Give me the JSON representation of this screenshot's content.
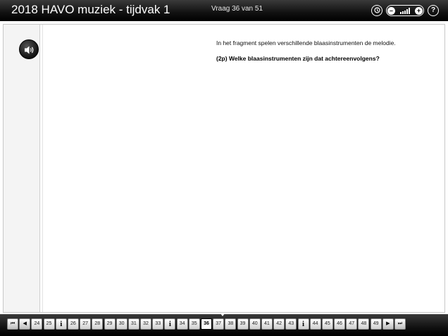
{
  "header": {
    "title": "2018 HAVO muziek - tijdvak 1",
    "counter": "Vraag 36 van 51",
    "icons": [
      "history-icon",
      "volume-control",
      "help-icon"
    ]
  },
  "question": {
    "text": "In het fragment spelen verschillende blaasinstrumenten de melodie.",
    "prompt": "(2p) Welke blaasinstrumenten zijn dat achtereenvolgens?"
  },
  "navigation": {
    "first": "⏮",
    "prev": "◀",
    "next": "▶",
    "last": "⏭",
    "current": "36",
    "items": [
      {
        "label": "24",
        "type": "q"
      },
      {
        "label": "25",
        "type": "q"
      },
      {
        "label": "i",
        "type": "info"
      },
      {
        "label": "26",
        "type": "q"
      },
      {
        "label": "27",
        "type": "q"
      },
      {
        "label": "28",
        "type": "q"
      },
      {
        "label": "29",
        "type": "q"
      },
      {
        "label": "30",
        "type": "q"
      },
      {
        "label": "31",
        "type": "q"
      },
      {
        "label": "32",
        "type": "q"
      },
      {
        "label": "33",
        "type": "q"
      },
      {
        "label": "i",
        "type": "info"
      },
      {
        "label": "34",
        "type": "q"
      },
      {
        "label": "35",
        "type": "q"
      },
      {
        "label": "36",
        "type": "current"
      },
      {
        "label": "37",
        "type": "q"
      },
      {
        "label": "38",
        "type": "q"
      },
      {
        "label": "39",
        "type": "q"
      },
      {
        "label": "40",
        "type": "q"
      },
      {
        "label": "41",
        "type": "q"
      },
      {
        "label": "42",
        "type": "q"
      },
      {
        "label": "43",
        "type": "q"
      },
      {
        "label": "i",
        "type": "info"
      },
      {
        "label": "44",
        "type": "q"
      },
      {
        "label": "45",
        "type": "q"
      },
      {
        "label": "46",
        "type": "q"
      },
      {
        "label": "47",
        "type": "q"
      },
      {
        "label": "48",
        "type": "q"
      },
      {
        "label": "49",
        "type": "q"
      }
    ]
  }
}
